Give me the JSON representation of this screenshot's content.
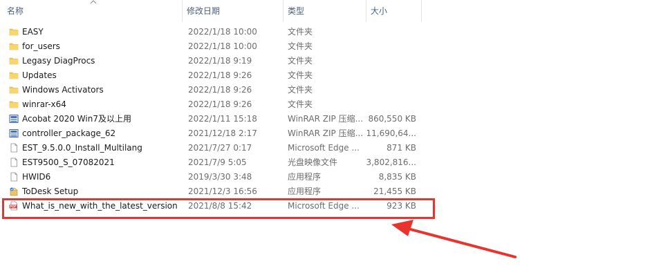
{
  "columns": {
    "name": "名称",
    "date_modified": "修改日期",
    "type": "类型",
    "size": "大小"
  },
  "files": [
    {
      "name": "EASY",
      "date": "2022/1/18 10:00",
      "type": "文件夹",
      "size": "",
      "icon": "folder-icon"
    },
    {
      "name": "for_users",
      "date": "2022/1/18 10:00",
      "type": "文件夹",
      "size": "",
      "icon": "folder-icon"
    },
    {
      "name": "Legasy DiagProcs",
      "date": "2022/1/18 9:19",
      "type": "文件夹",
      "size": "",
      "icon": "folder-icon"
    },
    {
      "name": "Updates",
      "date": "2022/1/18 9:26",
      "type": "文件夹",
      "size": "",
      "icon": "folder-icon"
    },
    {
      "name": "Windows Activators",
      "date": "2022/1/18 9:26",
      "type": "文件夹",
      "size": "",
      "icon": "folder-icon"
    },
    {
      "name": "winrar-x64",
      "date": "2022/1/18 9:26",
      "type": "文件夹",
      "size": "",
      "icon": "folder-icon"
    },
    {
      "name": "Acobat 2020 Win7及以上用",
      "date": "2022/1/11 15:18",
      "type": "WinRAR ZIP 压缩...",
      "size": "860,550 KB",
      "icon": "zip-archive-icon"
    },
    {
      "name": "controller_package_62",
      "date": "2021/12/18 2:17",
      "type": "WinRAR ZIP 压缩...",
      "size": "11,690,64...",
      "icon": "zip-archive-icon"
    },
    {
      "name": "EST_9.5.0.0_Install_Multilang",
      "date": "2021/7/27 0:17",
      "type": "Microsoft Edge ...",
      "size": "871 KB",
      "icon": "document-icon"
    },
    {
      "name": "EST9500_S_07082021",
      "date": "2021/7/9 5:05",
      "type": "光盘映像文件",
      "size": "3,802,816...",
      "icon": "document-icon"
    },
    {
      "name": "HWID6",
      "date": "2019/3/30 3:48",
      "type": "应用程序",
      "size": "8,835 KB",
      "icon": "document-icon"
    },
    {
      "name": "ToDesk Setup",
      "date": "2021/12/3 16:56",
      "type": "应用程序",
      "size": "21,455 KB",
      "icon": "installer-icon"
    },
    {
      "name": "What_is_new_with_the_latest_version",
      "date": "2021/8/8 15:42",
      "type": "Microsoft Edge ...",
      "size": "923 KB",
      "icon": "pdf-icon"
    }
  ],
  "colors": {
    "annotation_red": "#e8332f",
    "folder_yellow": "#f2c94c",
    "header_text": "#4c607a"
  }
}
